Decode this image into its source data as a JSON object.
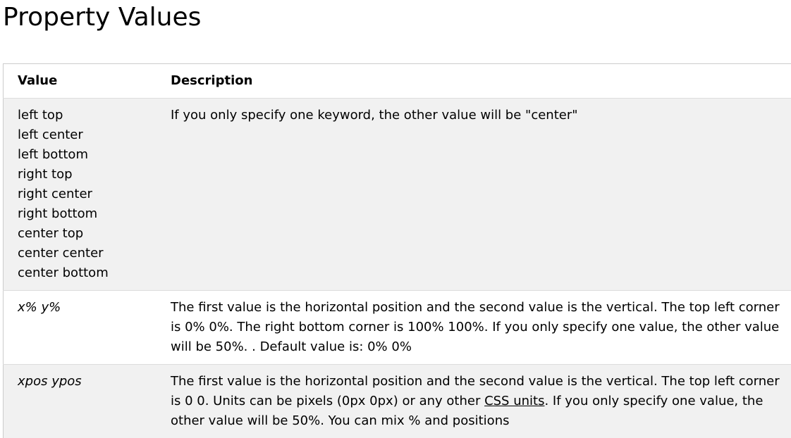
{
  "page": {
    "title": "Property Values"
  },
  "table": {
    "headers": {
      "value": "Value",
      "description": "Description"
    },
    "rows": [
      {
        "values": [
          "left top",
          "left center",
          "left bottom",
          "right top",
          "right center",
          "right bottom",
          "center top",
          "center center",
          "center bottom"
        ],
        "description": "If you only specify one keyword, the other value will be \"center\""
      },
      {
        "value": "x% y%",
        "description": "The first value is the horizontal position and the second value is the vertical. The top left corner is 0% 0%. The right bottom corner is 100% 100%. If you only specify one value, the other value will be 50%. . Default value is: 0% 0%"
      },
      {
        "value": "xpos ypos",
        "description_before": "The first value is the horizontal position and the second value is the vertical. The top left corner is 0 0. Units can be pixels (0px 0px) or any other ",
        "link_text": "CSS units",
        "description_after": ". If you only specify one value, the other value will be 50%. You can mix % and positions"
      }
    ]
  }
}
